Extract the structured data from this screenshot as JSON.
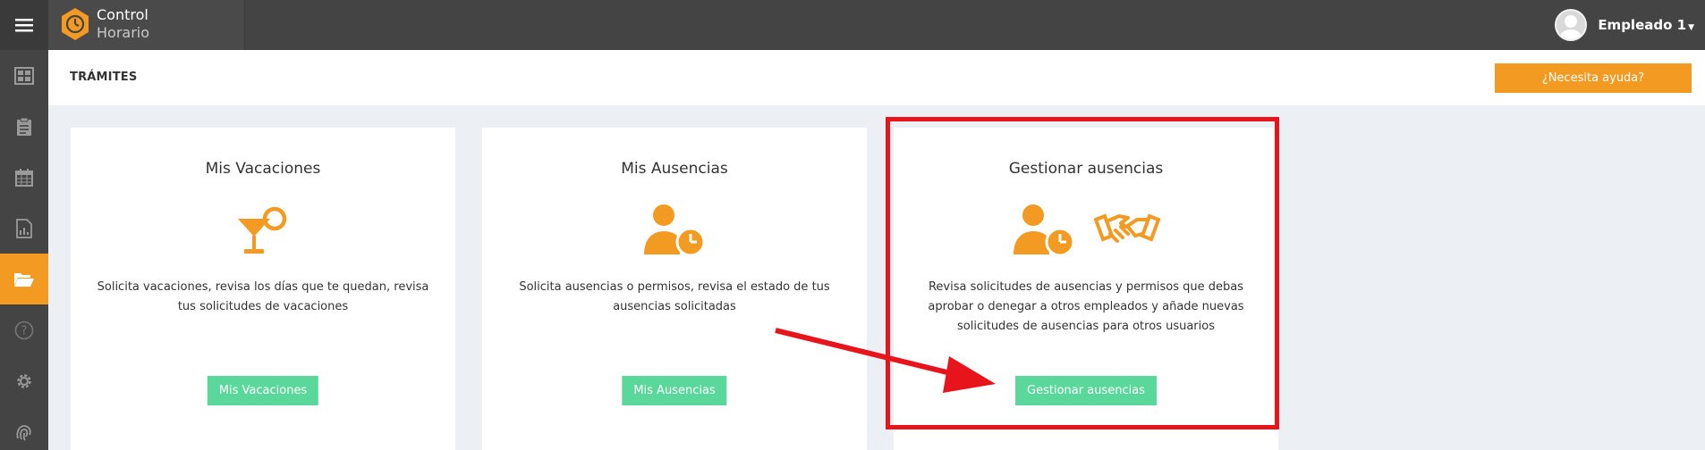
{
  "app": {
    "brand_line1": "Control",
    "brand_line2": "Horario",
    "accent_color": "#f39a22",
    "button_color": "#5ad79b"
  },
  "user": {
    "name": "Empleado 1"
  },
  "sidebar": {
    "items": [
      {
        "icon": "dashboard-icon"
      },
      {
        "icon": "clipboard-icon"
      },
      {
        "icon": "calendar-icon"
      },
      {
        "icon": "report-icon"
      },
      {
        "icon": "folder-open-icon",
        "active": true
      },
      {
        "icon": "help-icon"
      },
      {
        "icon": "gear-icon"
      },
      {
        "icon": "fingerprint-icon"
      }
    ]
  },
  "header": {
    "title": "TRÁMITES",
    "help_label": "¿Necesita ayuda?"
  },
  "cards": [
    {
      "title": "Mis Vacaciones",
      "description": "Solicita vacaciones, revisa los días que te quedan, revisa tus solicitudes de vacaciones",
      "button": "Mis Vacaciones"
    },
    {
      "title": "Mis Ausencias",
      "description": "Solicita ausencias o permisos, revisa el estado de tus ausencias solicitadas",
      "button": "Mis Ausencias"
    },
    {
      "title": "Gestionar ausencias",
      "description": "Revisa solicitudes de ausencias y permisos que debas aprobar o denegar a otros empleados y añade nuevas solicitudes de ausencias para otros usuarios",
      "button": "Gestionar ausencias"
    }
  ]
}
